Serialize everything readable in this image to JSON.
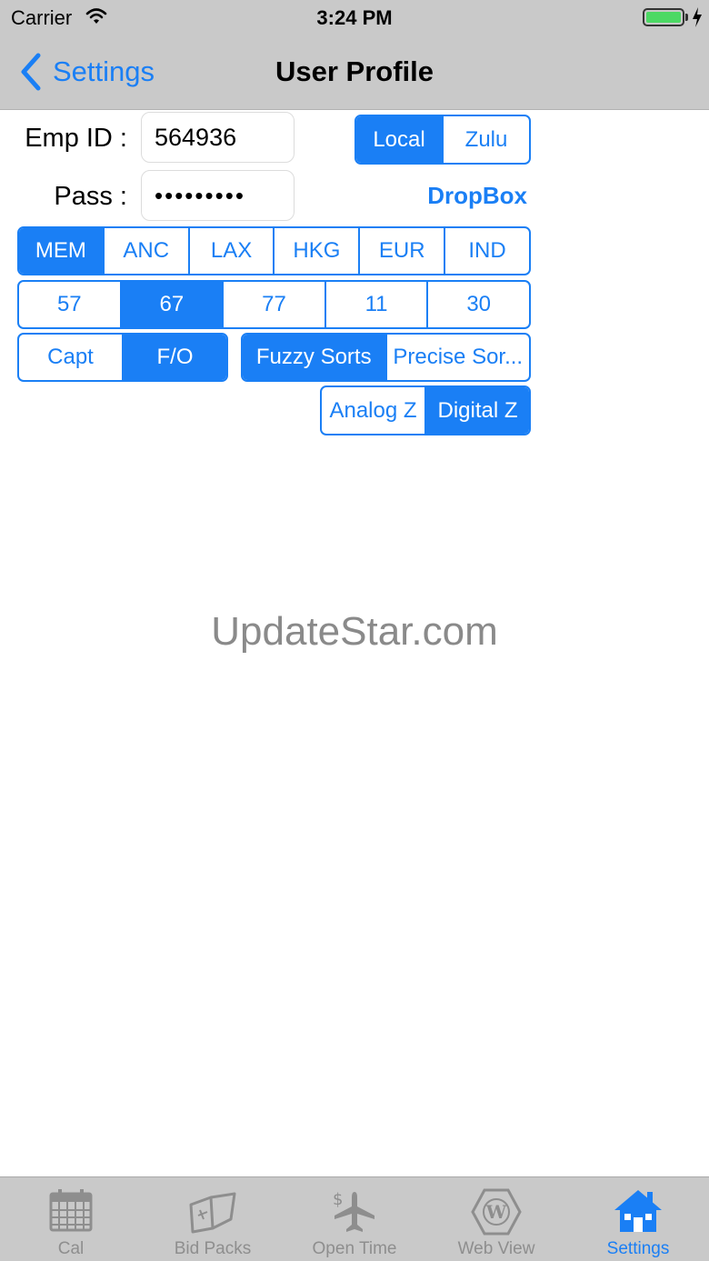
{
  "status_bar": {
    "carrier": "Carrier",
    "time": "3:24 PM"
  },
  "nav": {
    "back_label": "Settings",
    "title": "User Profile"
  },
  "form": {
    "emp_id_label": "Emp ID :",
    "emp_id_value": "564936",
    "pass_label": "Pass :",
    "pass_value": "•••••••••",
    "dropbox_label": "DropBox"
  },
  "time_mode": {
    "options": [
      "Local",
      "Zulu"
    ],
    "selected": "Local"
  },
  "bases": {
    "options": [
      "MEM",
      "ANC",
      "LAX",
      "HKG",
      "EUR",
      "IND"
    ],
    "selected": "MEM"
  },
  "fleet": {
    "options": [
      "57",
      "67",
      "77",
      "11",
      "30"
    ],
    "selected": "67"
  },
  "seat": {
    "options": [
      "Capt",
      "F/O"
    ],
    "selected": "F/O"
  },
  "sorts": {
    "options": [
      "Fuzzy Sorts",
      "Precise Sor..."
    ],
    "selected": "Fuzzy Sorts"
  },
  "zclock": {
    "options": [
      "Analog Z",
      "Digital Z"
    ],
    "selected": "Digital Z"
  },
  "watermark": "UpdateStar.com",
  "tabbar": {
    "tabs": [
      {
        "label": "Cal",
        "icon": "calendar-icon"
      },
      {
        "label": "Bid Packs",
        "icon": "open-book-icon"
      },
      {
        "label": "Open Time",
        "icon": "airplane-dollar-icon"
      },
      {
        "label": "Web View",
        "icon": "web-hexagon-icon"
      },
      {
        "label": "Settings",
        "icon": "house-icon",
        "active": true
      }
    ]
  },
  "colors": {
    "accent": "#1a7ff5",
    "bar_bg": "#c9c9c9",
    "inactive": "#8e8e8e"
  }
}
